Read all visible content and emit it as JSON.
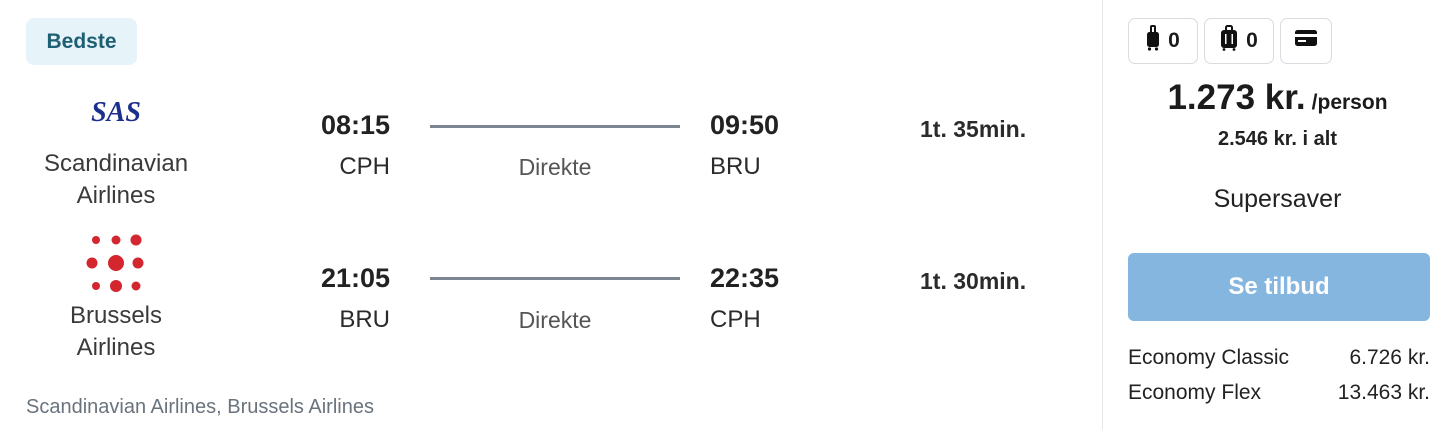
{
  "badge": "Bedste",
  "legs": [
    {
      "airline": "Scandinavian Airlines",
      "airline_line1": "Scandinavian",
      "airline_line2": "Airlines",
      "logo_text": "SAS",
      "dep_time": "08:15",
      "dep_code": "CPH",
      "stops": "Direkte",
      "arr_time": "09:50",
      "arr_code": "BRU",
      "duration": "1t. 35min."
    },
    {
      "airline": "Brussels Airlines",
      "airline_line1": "Brussels",
      "airline_line2": "Airlines",
      "dep_time": "21:05",
      "dep_code": "BRU",
      "stops": "Direkte",
      "arr_time": "22:35",
      "arr_code": "CPH",
      "duration": "1t. 30min."
    }
  ],
  "operators": "Scandinavian Airlines, Brussels Airlines",
  "baggage": {
    "carry_on_icon": "carry-on-bag-icon",
    "carry_on_count": "0",
    "checked_icon": "checked-bag-icon",
    "checked_count": "0",
    "payment_icon": "credit-card-icon"
  },
  "price": {
    "amount": "1.273 kr.",
    "unit": "/person",
    "total": "2.546 kr. i alt",
    "fare_name": "Supersaver"
  },
  "cta_label": "Se tilbud",
  "alternative_fares": [
    {
      "name": "Economy Classic",
      "price": "6.726 kr."
    },
    {
      "name": "Economy Flex",
      "price": "13.463 kr."
    }
  ],
  "colors": {
    "badge_bg": "#e6f3f8",
    "badge_text": "#1f5f74",
    "cta_bg": "#84b6e0",
    "sas_blue": "#1d2f8c",
    "brussels_red": "#d3262f"
  }
}
